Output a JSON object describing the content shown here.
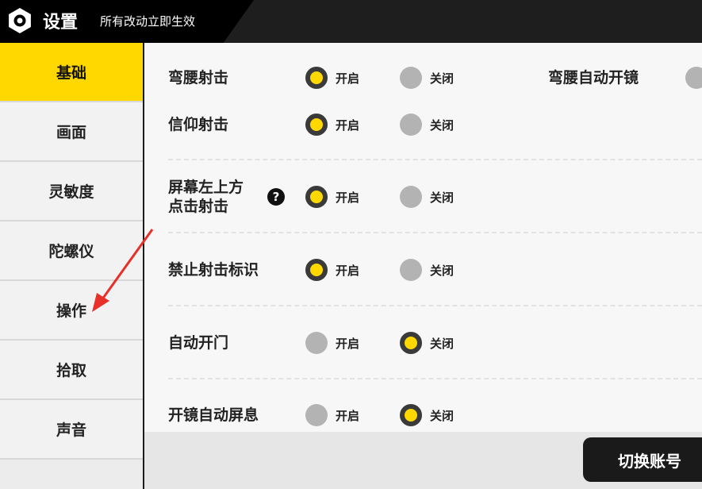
{
  "header": {
    "title": "设置",
    "subtitle": "所有改动立即生效"
  },
  "sidebar": {
    "items": [
      {
        "label": "基础",
        "active": true
      },
      {
        "label": "画面",
        "active": false
      },
      {
        "label": "灵敏度",
        "active": false
      },
      {
        "label": "陀螺仪",
        "active": false
      },
      {
        "label": "操作",
        "active": false
      },
      {
        "label": "拾取",
        "active": false
      },
      {
        "label": "声音",
        "active": false
      }
    ]
  },
  "settings": {
    "on_label": "开启",
    "off_label": "关闭",
    "rows": [
      {
        "label": "弯腰射击",
        "value": "开启"
      },
      {
        "label": "信仰射击",
        "value": "开启"
      },
      {
        "label": "屏幕左上方点击射击",
        "label_line1": "屏幕左上方",
        "label_line2": "点击射击",
        "value": "开启",
        "help": "?"
      },
      {
        "label": "禁止射击标识",
        "value": "开启"
      },
      {
        "label": "自动开门",
        "value": "关闭"
      },
      {
        "label": "开镜自动屏息",
        "value": "关闭"
      }
    ],
    "extra": {
      "label": "弯腰自动开镜"
    }
  },
  "bottom": {
    "switch_account_label": "切换账号"
  },
  "colors": {
    "accent": "#ffd800",
    "dark": "#1a1a1a",
    "radio_off": "#b3b3b3"
  }
}
